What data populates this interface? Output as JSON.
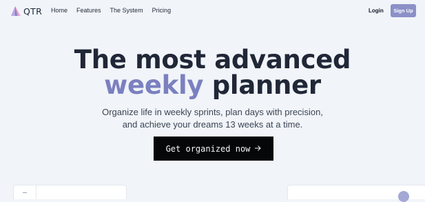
{
  "brand": {
    "name": "QTR",
    "accent": "#7b80c0",
    "logo_icon": "triangle-logo-icon"
  },
  "nav": {
    "links": [
      {
        "label": "Home"
      },
      {
        "label": "Features"
      },
      {
        "label": "The System"
      },
      {
        "label": "Pricing"
      }
    ],
    "login_label": "Login",
    "signup_label": "Sign Up"
  },
  "hero": {
    "title_line1": "The most advanced",
    "title_accent": "weekly",
    "title_rest": "planner",
    "subtitle_line1": "Organize life in weekly sprints, plan days with precision,",
    "subtitle_line2": "and achieve your dreams 13 weeks at a time.",
    "cta_label": "Get organized now",
    "cta_icon": "arrow-right-icon"
  },
  "colors": {
    "background": "#f1f4f8",
    "signup_bg": "#8b90c7",
    "cta_bg": "#060709",
    "heading": "#202737"
  }
}
